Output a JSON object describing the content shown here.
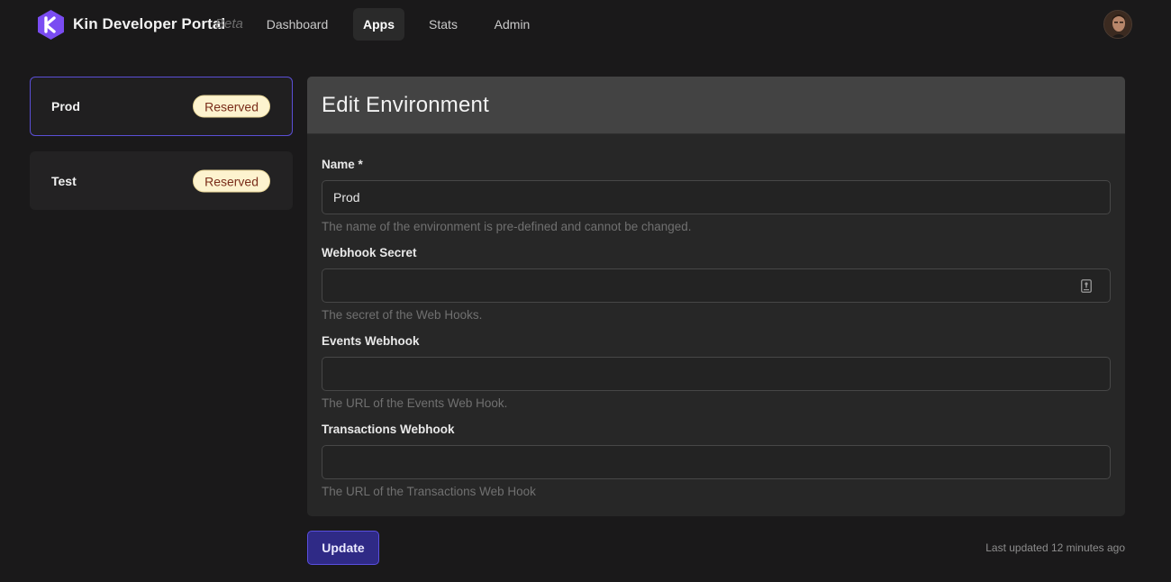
{
  "header": {
    "brand_title": "Kin Developer Portal",
    "brand_beta": "Beta",
    "logo_icon": "kin-logo-icon",
    "tabs": [
      {
        "label": "Dashboard",
        "active": false
      },
      {
        "label": "Apps",
        "active": true
      },
      {
        "label": "Stats",
        "active": false
      },
      {
        "label": "Admin",
        "active": false
      }
    ],
    "avatar_icon": "user-avatar-icon"
  },
  "environments": [
    {
      "name": "Prod",
      "badge": "Reserved",
      "selected": true
    },
    {
      "name": "Test",
      "badge": "Reserved",
      "selected": false
    }
  ],
  "form": {
    "title": "Edit Environment",
    "fields": {
      "name": {
        "label": "Name *",
        "value": "Prod",
        "help": "The name of the environment is pre-defined and cannot be changed."
      },
      "webhook_secret": {
        "label": "Webhook Secret",
        "value": "",
        "help": "The secret of the Web Hooks.",
        "icon": "password-manager-key-icon"
      },
      "events_webhook": {
        "label": "Events Webhook",
        "value": "",
        "help": "The URL of the Events Web Hook."
      },
      "transactions_webhook": {
        "label": "Transactions Webhook",
        "value": "",
        "help": "The URL of the Transactions Web Hook"
      }
    },
    "update_label": "Update",
    "last_updated": "Last updated 12 minutes ago"
  },
  "colors": {
    "background": "#1a191a",
    "accent": "#5b4fd6",
    "button_bg": "#2f2a86",
    "badge_bg": "#fdf3cf",
    "badge_text": "#7a2d1a"
  }
}
